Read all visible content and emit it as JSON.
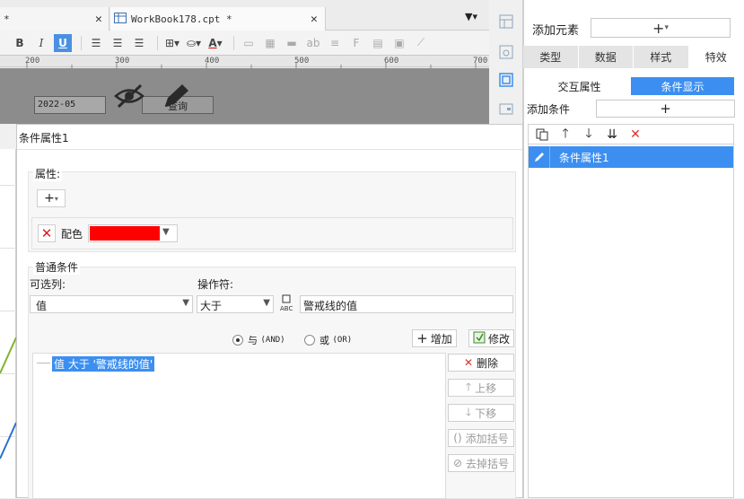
{
  "tabs": {
    "left_tab_mark": "*",
    "active_tab_title": "WorkBook178.cpt *"
  },
  "ruler": {
    "ticks": [
      "200",
      "300",
      "400",
      "500",
      "600",
      "700"
    ]
  },
  "sheet": {
    "date_value": "2022-05",
    "query_label": "查询"
  },
  "right_panel": {
    "add_element_label": "添加元素",
    "tabs": [
      "类型",
      "数据",
      "样式",
      "特效"
    ],
    "active_tab": "特效",
    "sub_tabs": [
      "交互属性",
      "条件显示"
    ],
    "active_sub_tab": "条件显示",
    "add_condition_label": "添加条件",
    "conditions": [
      {
        "label": "条件属性1",
        "selected": true
      }
    ]
  },
  "dialog": {
    "title": "条件属性1",
    "attr_section_label": "属性:",
    "attr_item_name": "配色",
    "attr_color": "#ff0000",
    "cond_section_label": "普通条件",
    "column_label": "可选列:",
    "column_value": "值",
    "operator_label": "操作符:",
    "operator_value": "大于",
    "value_text": "警戒线的值",
    "and_prefix": "与",
    "and_suffix": "(AND)",
    "or_prefix": "或",
    "or_suffix": "(OR)",
    "and_selected": true,
    "add_button": "增加",
    "edit_button": "修改",
    "expression": "值 大于 '警戒线的值'",
    "delete_button": "删除",
    "move_up_button": "上移",
    "move_down_button": "下移",
    "add_bracket_button": "添加括号",
    "remove_bracket_button": "去掉括号"
  },
  "colors": {
    "accent": "#3c8ff0",
    "delete_red": "#e03030"
  }
}
